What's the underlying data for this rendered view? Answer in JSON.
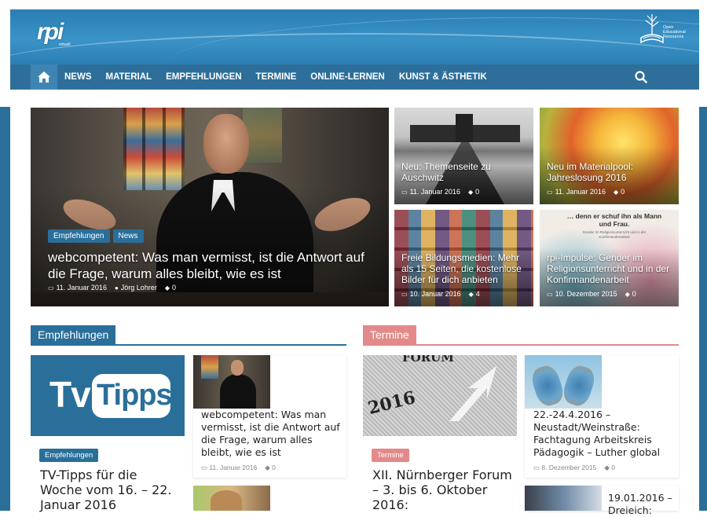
{
  "header": {
    "logo_text": "rpi",
    "logo_sub": "virtuell",
    "oer_lines": [
      "Open",
      "Educational",
      "Resources"
    ]
  },
  "nav": {
    "items": [
      "NEWS",
      "MATERIAL",
      "EMPFEHLUNGEN",
      "TERMINE",
      "ONLINE-LERNEN",
      "KUNST & ÄSTHETIK"
    ]
  },
  "featured": {
    "main": {
      "tags": [
        "Empfehlungen",
        "News"
      ],
      "title": "webcompetent: Was man vermisst, ist die Antwort auf die Frage, warum alles bleibt, wie es ist",
      "date": "11. Januar 2016",
      "author": "Jörg Lohrer",
      "comments": "0"
    },
    "tiles": [
      {
        "title": "Neu: Themenseite zu Auschwitz",
        "date": "11. Januar 2016",
        "comments": "0"
      },
      {
        "title": "Neu im Materialpool: Jahreslosung 2016",
        "date": "11. Januar 2016",
        "comments": "0"
      },
      {
        "title": "Freie Bildungsmedien: Mehr als 15 Seiten, die kostenlose Bilder für dich anbieten",
        "date": "10. Januar 2016",
        "comments": "4"
      },
      {
        "title": "rpi-Impulse: Gender im Religionsunterricht und in der Konfirmandenarbeit",
        "date": "10. Dezember 2015",
        "comments": "0",
        "image_text": "… denn er schuf ihn als Mann und Frau.",
        "image_subtext": "Gender im Religionsunterricht und in der Konfirmandenarbeit"
      }
    ]
  },
  "empfehlungen": {
    "heading": "Empfehlungen",
    "color": "#2a6f9a",
    "big": {
      "image_text": [
        "Tv",
        "Tipps"
      ],
      "badge": "Empfehlungen",
      "title": "TV-Tipps für die Woche vom 16. – 22. Januar 2016"
    },
    "small": {
      "title": "webcompetent: Was man vermisst, ist die Antwort auf die Frage, warum alles bleibt, wie es ist",
      "date": "11. Januar 2016",
      "comments": "0"
    }
  },
  "termine": {
    "heading": "Termine",
    "color": "#e3898a",
    "big": {
      "image_text": [
        "FORUM",
        "2016"
      ],
      "badge": "Termine",
      "title": "XII. Nürnberger Forum – 3. bis 6. Oktober 2016:"
    },
    "small": {
      "title": "22.-24.4.2016 – Neustadt/Weinstraße: Fachtagung Arbeitskreis Pädagogik – Luther global",
      "date": "8. Dezember 2015",
      "comments": "0"
    },
    "small2": {
      "title": "19.01.2016 – Dreieich:"
    }
  }
}
